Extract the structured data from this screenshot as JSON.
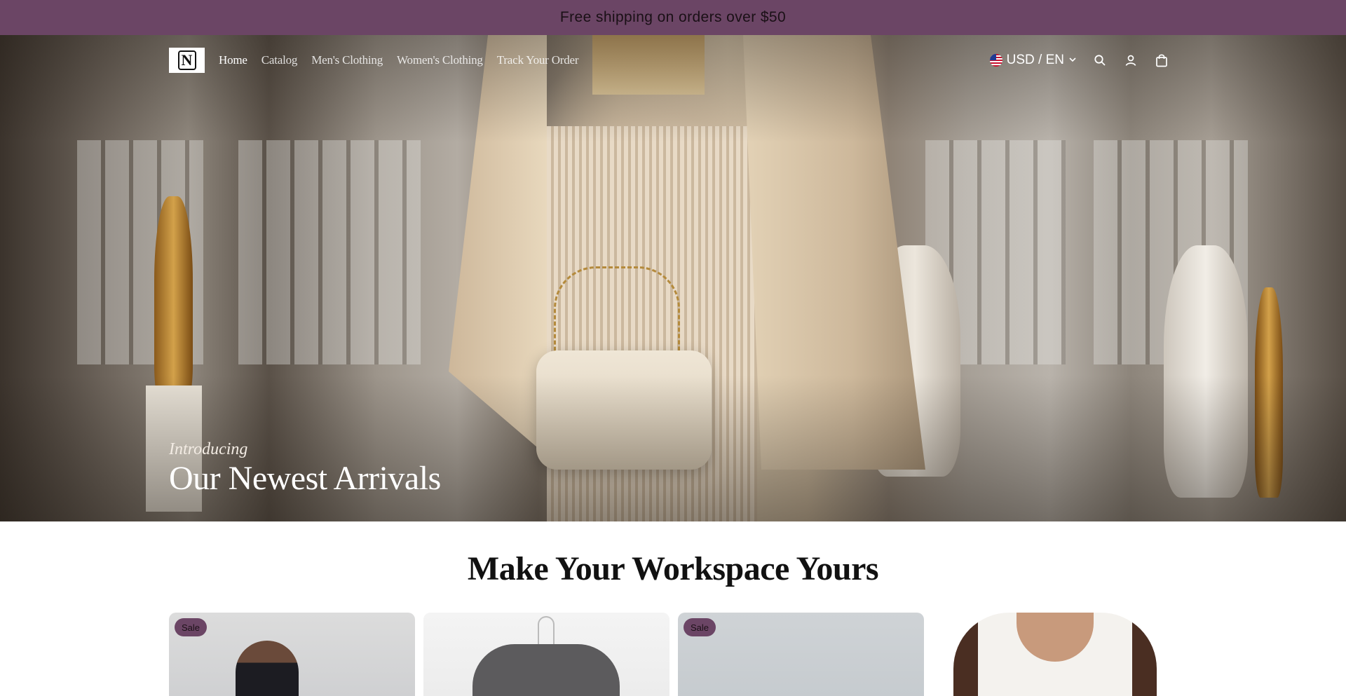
{
  "announcement": {
    "text": "Free shipping on orders over $50"
  },
  "header": {
    "logo_letter": "N",
    "nav": [
      {
        "label": "Home",
        "active": true
      },
      {
        "label": "Catalog",
        "active": false
      },
      {
        "label": "Men's Clothing",
        "active": false
      },
      {
        "label": "Women's Clothing",
        "active": false
      },
      {
        "label": "Track Your Order",
        "active": false
      }
    ],
    "locale": "USD / EN",
    "icons": [
      "us-flag-icon",
      "chevron-down-icon",
      "search-icon",
      "account-icon",
      "cart-icon"
    ]
  },
  "hero": {
    "subtitle": "Introducing",
    "title": "Our Newest Arrivals"
  },
  "section": {
    "title": "Make Your Workspace Yours",
    "products": [
      {
        "badge": "Sale"
      },
      {
        "badge": ""
      },
      {
        "badge": "Sale"
      },
      {
        "badge": ""
      }
    ]
  },
  "colors": {
    "brand": "#6b4565",
    "text": "#111111",
    "white": "#ffffff"
  }
}
